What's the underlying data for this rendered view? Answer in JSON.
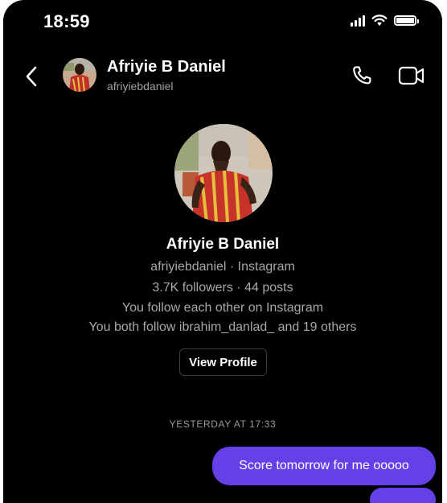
{
  "status_bar": {
    "time": "18:59"
  },
  "header": {
    "name": "Afriyie B Daniel",
    "username": "afriyiebdaniel"
  },
  "profile": {
    "name": "Afriyie B Daniel",
    "source_line": "afriyiebdaniel · Instagram",
    "stats_line": "3.7K followers · 44 posts",
    "mutual_line": "You follow each other on Instagram",
    "shared_followers_line": "You both follow ibrahim_danlad_ and 19 others",
    "view_profile_label": "View Profile"
  },
  "conversation": {
    "timestamp": "YESTERDAY AT 17:33",
    "messages": [
      {
        "sender": "me",
        "text": "Score tomorrow for me ooooo"
      },
      {
        "sender": "me",
        "text": ""
      }
    ]
  },
  "colors": {
    "background": "#000000",
    "outgoing_bubble": "#6540e8",
    "secondary_text": "#a8a8a8"
  },
  "icons": [
    "back-chevron-icon",
    "phone-icon",
    "video-camera-icon",
    "signal-icon",
    "wifi-icon",
    "battery-icon"
  ]
}
